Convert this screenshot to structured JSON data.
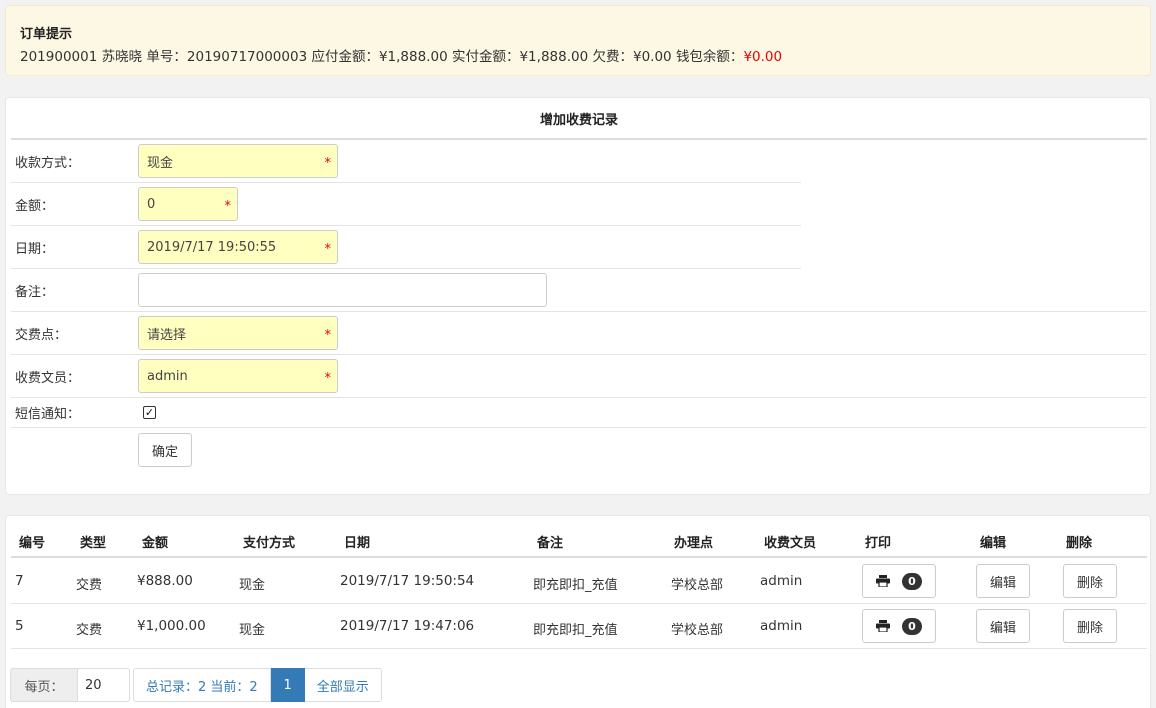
{
  "notice": {
    "title": "订单提示",
    "student_id": "201900001",
    "student_name": "苏晓晓",
    "order_label": "单号：",
    "order_no": "20190717000003",
    "payable_label": "应付金额：",
    "payable": "¥1,888.00",
    "paid_label": "实付金额：",
    "paid": "¥1,888.00",
    "owed_label": "欠费：",
    "owed": "¥0.00",
    "wallet_label": "钱包余额：",
    "wallet": "¥0.00",
    "wallet_color": "#ee0000"
  },
  "form": {
    "title": "增加收费记录",
    "method_label": "收款方式：",
    "method_value": "现金",
    "amount_label": "金额：",
    "amount_value": "0",
    "date_label": "日期：",
    "date_value": "2019/7/17 19:50:55",
    "note_label": "备注：",
    "note_value": "",
    "point_label": "交费点：",
    "point_value": "请选择",
    "clerk_label": "收费文员：",
    "clerk_value": "admin",
    "sms_label": "短信通知：",
    "sms_checked": true,
    "required_mark": "*",
    "submit_label": "确定"
  },
  "table": {
    "headers": [
      "编号",
      "类型",
      "金额",
      "支付方式",
      "日期",
      "备注",
      "办理点",
      "收费文员",
      "打印",
      "编辑",
      "删除"
    ],
    "rows": [
      {
        "id": "7",
        "type": "交费",
        "amount": "¥888.00",
        "method": "现金",
        "date": "2019/7/17 19:50:54",
        "note": "即充即扣_充值",
        "point": "学校总部",
        "clerk": "admin",
        "print_count": "0",
        "edit": "编辑",
        "delete": "删除"
      },
      {
        "id": "5",
        "type": "交费",
        "amount": "¥1,000.00",
        "method": "现金",
        "date": "2019/7/17 19:47:06",
        "note": "即充即扣_充值",
        "point": "学校总部",
        "clerk": "admin",
        "print_count": "0",
        "edit": "编辑",
        "delete": "删除"
      }
    ]
  },
  "pager": {
    "per_page_label": "每页：",
    "per_page_value": "20",
    "summary": "总记录：2 当前：2",
    "current_page": "1",
    "show_all": "全部显示"
  },
  "colors": {
    "notice_bg": "#fcf8e3",
    "required_bg": "#ffffc0",
    "pager_active": "#337ab7"
  },
  "icons": [
    "printer-icon",
    "check-icon"
  ]
}
